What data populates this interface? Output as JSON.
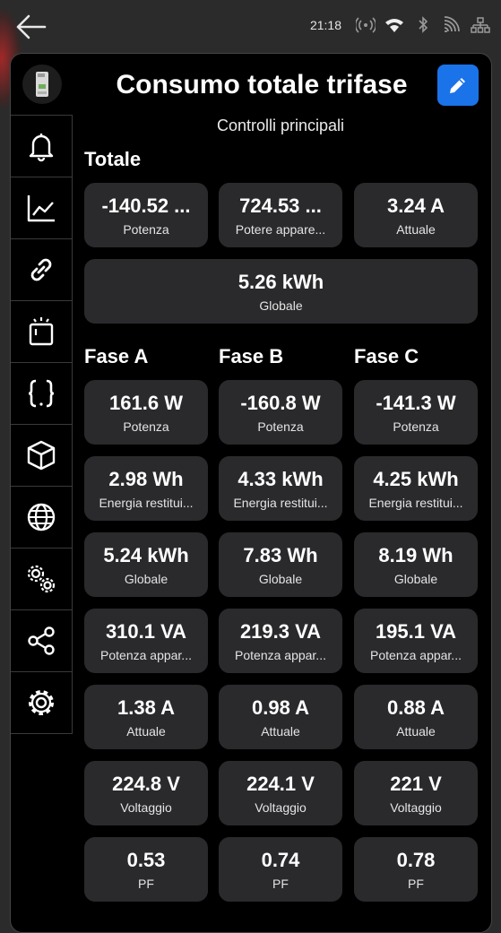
{
  "status": {
    "time": "21:18"
  },
  "header": {
    "title": "Consumo totale trifase",
    "subtitle": "Controlli principali"
  },
  "sidebar": {
    "items": [
      "bell",
      "chart",
      "link",
      "device",
      "code",
      "cube",
      "globe",
      "gears",
      "share",
      "settings"
    ]
  },
  "totale": {
    "heading": "Totale",
    "cards": [
      {
        "value": "-140.52 ...",
        "label": "Potenza"
      },
      {
        "value": "724.53 ...",
        "label": "Potere appare..."
      },
      {
        "value": "3.24 A",
        "label": "Attuale"
      }
    ],
    "global": {
      "value": "5.26 kWh",
      "label": "Globale"
    }
  },
  "phases": {
    "headings": [
      "Fase A",
      "Fase B",
      "Fase C"
    ],
    "rows": [
      [
        {
          "value": "161.6 W",
          "label": "Potenza"
        },
        {
          "value": "-160.8 W",
          "label": "Potenza"
        },
        {
          "value": "-141.3 W",
          "label": "Potenza"
        }
      ],
      [
        {
          "value": "2.98 Wh",
          "label": "Energia restitui..."
        },
        {
          "value": "4.33 kWh",
          "label": "Energia restitui..."
        },
        {
          "value": "4.25 kWh",
          "label": "Energia restitui..."
        }
      ],
      [
        {
          "value": "5.24 kWh",
          "label": "Globale"
        },
        {
          "value": "7.83 Wh",
          "label": "Globale"
        },
        {
          "value": "8.19 Wh",
          "label": "Globale"
        }
      ],
      [
        {
          "value": "310.1 VA",
          "label": "Potenza appar..."
        },
        {
          "value": "219.3 VA",
          "label": "Potenza appar..."
        },
        {
          "value": "195.1 VA",
          "label": "Potenza appar..."
        }
      ],
      [
        {
          "value": "1.38 A",
          "label": "Attuale"
        },
        {
          "value": "0.98 A",
          "label": "Attuale"
        },
        {
          "value": "0.88 A",
          "label": "Attuale"
        }
      ],
      [
        {
          "value": "224.8 V",
          "label": "Voltaggio"
        },
        {
          "value": "224.1 V",
          "label": "Voltaggio"
        },
        {
          "value": "221 V",
          "label": "Voltaggio"
        }
      ],
      [
        {
          "value": "0.53",
          "label": "PF"
        },
        {
          "value": "0.74",
          "label": "PF"
        },
        {
          "value": "0.78",
          "label": "PF"
        }
      ]
    ]
  },
  "colors": {
    "accent": "#1a73e8",
    "card": "#2a2a2d",
    "panel": "#000000"
  }
}
